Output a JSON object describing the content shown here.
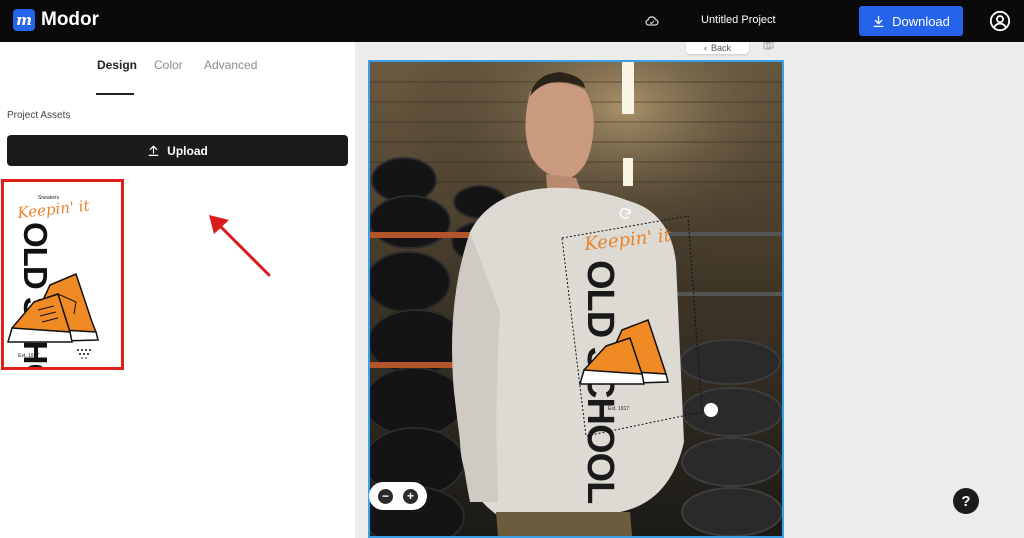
{
  "header": {
    "brand_name": "Modor",
    "brand_logo_letter": "m",
    "project_name": "Untitled Project",
    "download_label": "Download",
    "accent_color": "#2563eb"
  },
  "left_panel": {
    "tabs": [
      {
        "label": "Design",
        "active": true
      },
      {
        "label": "Color",
        "active": false
      },
      {
        "label": "Advanced",
        "active": false
      }
    ],
    "section_label": "Project Assets",
    "upload_label": "Upload",
    "asset": {
      "script_text": "Keepin' it",
      "main_text": "OLD SCHOOL",
      "small_text": "Sneakers",
      "footer_text": "Est. 1917",
      "highlight_color": "#e0201b"
    }
  },
  "canvas": {
    "back_label": "Back",
    "zoom_out": "−",
    "zoom_in": "+",
    "border_color": "#3aa0e8"
  },
  "help_label": "?",
  "icons": [
    "cloud-icon",
    "download-icon",
    "user-icon",
    "upload-icon",
    "arrow-icon",
    "rotate-icon",
    "copy-icon"
  ]
}
